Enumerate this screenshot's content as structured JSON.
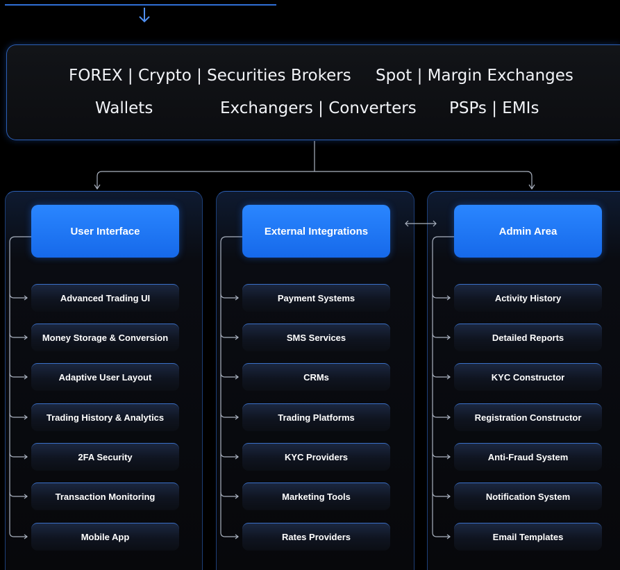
{
  "header": {
    "row1": [
      "FOREX | Crypto | Securities Brokers",
      "Spot | Margin Exchanges"
    ],
    "row2": [
      "Wallets",
      "Exchangers | Converters",
      "PSPs | EMIs"
    ]
  },
  "columns": [
    {
      "title": "User Interface",
      "items": [
        "Advanced Trading UI",
        "Money Storage & Conversion",
        "Adaptive User Layout",
        "Trading History & Analytics",
        "2FA Security",
        "Transaction Monitoring",
        "Mobile App"
      ]
    },
    {
      "title": "External Integrations",
      "items": [
        "Payment Systems",
        "SMS Services",
        "CRMs",
        "Trading Platforms",
        "KYC Providers",
        "Marketing Tools",
        "Rates Providers"
      ]
    },
    {
      "title": "Admin Area",
      "items": [
        "Activity History",
        "Detailed Reports",
        "KYC Constructor",
        "Registration Constructor",
        "Anti-Fraud System",
        "Notification System",
        "Email Templates"
      ]
    }
  ],
  "colors": {
    "accent": "#1f78ff",
    "line": "#aab2c0",
    "border": "#2c5fb5"
  },
  "icons": [
    "down-arrow-icon",
    "double-arrow-icon",
    "right-arrow-icon"
  ]
}
